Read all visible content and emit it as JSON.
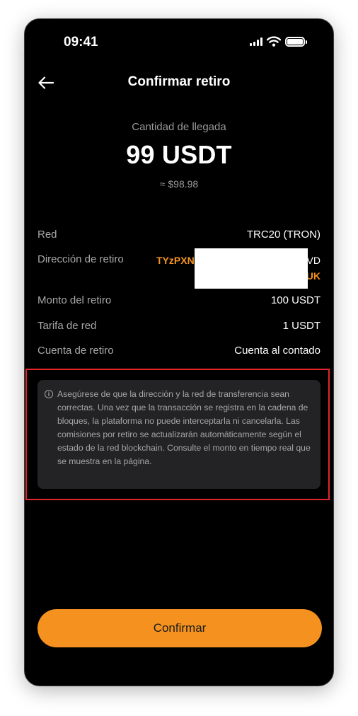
{
  "status_bar": {
    "time": "09:41",
    "icons": [
      "signal-icon",
      "wifi-icon",
      "battery-icon"
    ]
  },
  "header": {
    "title": "Confirmar retiro",
    "back_icon": "arrow-left-icon"
  },
  "arrival": {
    "label": "Cantidad de llegada",
    "amount": "99 USDT",
    "fiat": "≈ $98.98"
  },
  "details": {
    "network_label": "Red",
    "network_value": "TRC20 (TRON)",
    "address_label": "Dirección de retiro",
    "address_line1_start": "TYzPXN",
    "address_line1_end": "VD",
    "address_line2_end": "UK",
    "amount_label": "Monto del retiro",
    "amount_value": "100 USDT",
    "fee_label": "Tarifa de red",
    "fee_value": "1 USDT",
    "account_label": "Cuenta de retiro",
    "account_value": "Cuenta al contado"
  },
  "notice": {
    "icon": "info-icon",
    "text": "Asegúrese de que la dirección y la red de transferencia sean correctas. Una vez que la transacción se registra en la cadena de bloques, la plataforma no puede interceptarla ni cancelarla. Las comisiones por retiro se actualizarán automáticamente según el estado de la red blockchain. Consulte el monto en tiempo real que se muestra en la página."
  },
  "confirm_button": {
    "label": "Confirmar"
  },
  "colors": {
    "accent": "#f5921f",
    "background": "#000000",
    "notice_bg": "#232326",
    "highlight_frame": "#e0262a"
  }
}
